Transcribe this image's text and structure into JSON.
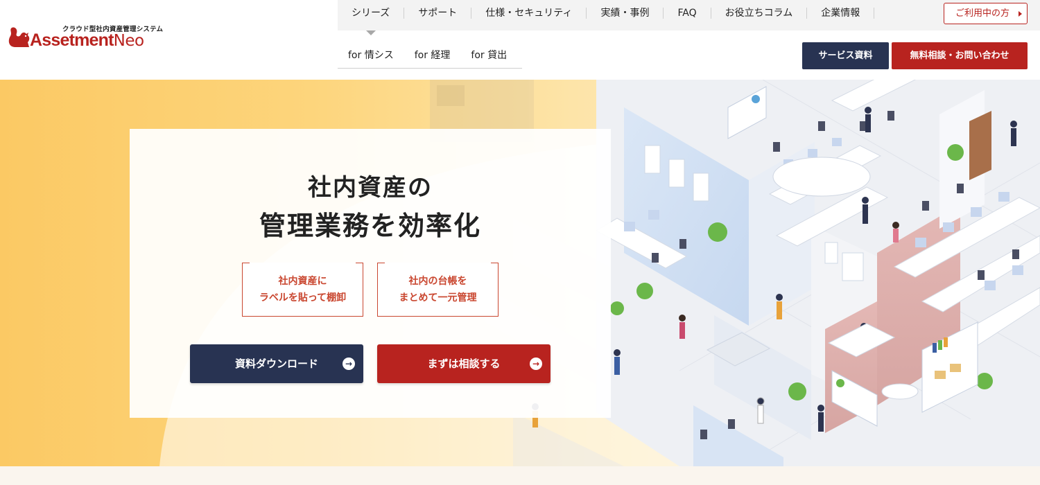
{
  "header": {
    "logo": {
      "tagline": "クラウド型社内資産管理システム",
      "brand_main": "Assetment",
      "brand_suffix": "Neo",
      "icon": "squirrel-logo-icon",
      "brand_color": "#b8231f"
    },
    "nav": {
      "items": [
        {
          "label": "シリーズ"
        },
        {
          "label": "サポート"
        },
        {
          "label": "仕様・セキュリティ"
        },
        {
          "label": "実績・事例"
        },
        {
          "label": "FAQ"
        },
        {
          "label": "お役立ちコラム"
        },
        {
          "label": "企業情報"
        }
      ],
      "active_index": 0,
      "sub_items": [
        {
          "label": "for 情シス"
        },
        {
          "label": "for 経理"
        },
        {
          "label": "for 貸出"
        }
      ]
    },
    "user_button": "ご利用中の方",
    "doc_button": "サービス資料",
    "contact_button": "無料相談・お問い合わせ"
  },
  "hero": {
    "title_line1": "社内資産の",
    "title_line2": "管理業務を効率化",
    "features": [
      {
        "line1": "社内資産に",
        "line2": "ラベルを貼って棚卸"
      },
      {
        "line1": "社内の台帳を",
        "line2": "まとめて一元管理"
      }
    ],
    "cta_download": "資料ダウンロード",
    "cta_consult": "まずは相談する",
    "colors": {
      "navy": "#283352",
      "red": "#b8231f",
      "hero_yellow": "#fbc964",
      "feature_border": "#c9462f"
    }
  }
}
